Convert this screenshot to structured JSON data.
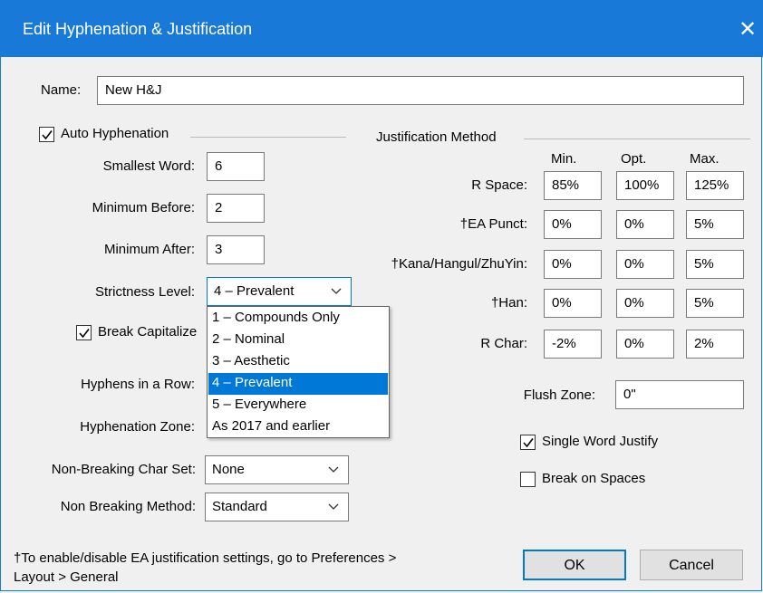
{
  "dialog": {
    "title": "Edit Hyphenation & Justification",
    "close_glyph": "✕"
  },
  "name": {
    "label": "Name:",
    "value": "New H&J"
  },
  "auto_hyphenation": {
    "label": "Auto Hyphenation",
    "checked": true,
    "smallest_word": {
      "label": "Smallest Word:",
      "value": "6"
    },
    "minimum_before": {
      "label": "Minimum Before:",
      "value": "2"
    },
    "minimum_after": {
      "label": "Minimum After:",
      "value": "3"
    },
    "strictness": {
      "label": "Strictness Level:",
      "value": "4 – Prevalent",
      "options": [
        "1 – Compounds Only",
        "2 – Nominal",
        "3 – Aesthetic",
        "4 – Prevalent",
        "5 – Everywhere",
        "As 2017 and earlier"
      ],
      "selected_index": 3
    },
    "break_capitalized": {
      "label": "Break Capitalize",
      "checked": true
    },
    "hyphens_in_row": {
      "label": "Hyphens in a Row:"
    },
    "hyphenation_zone": {
      "label": "Hyphenation Zone:"
    }
  },
  "non_breaking_char_set": {
    "label": "Non-Breaking Char Set:",
    "value": "None"
  },
  "non_breaking_method": {
    "label": "Non Breaking Method:",
    "value": "Standard"
  },
  "justification": {
    "heading": "Justification Method",
    "columns": [
      "Min.",
      "Opt.",
      "Max."
    ],
    "rows": [
      {
        "label": "R Space:",
        "min": "85%",
        "opt": "100%",
        "max": "125%"
      },
      {
        "label": "†EA Punct:",
        "min": "0%",
        "opt": "0%",
        "max": "5%"
      },
      {
        "label": "†Kana/Hangul/ZhuYin:",
        "min": "0%",
        "opt": "0%",
        "max": "5%"
      },
      {
        "label": "†Han:",
        "min": "0%",
        "opt": "0%",
        "max": "5%"
      },
      {
        "label": "R Char:",
        "min": "-2%",
        "opt": "0%",
        "max": "2%"
      }
    ],
    "flush_zone": {
      "label": "Flush Zone:",
      "value": "0\""
    },
    "single_word_justify": {
      "label": "Single Word Justify",
      "checked": true
    },
    "break_on_spaces": {
      "label": "Break on Spaces",
      "checked": false
    }
  },
  "footnote": {
    "line1": "†To enable/disable EA justification settings, go to Preferences >",
    "line2": "Layout > General"
  },
  "buttons": {
    "ok": "OK",
    "cancel": "Cancel"
  }
}
